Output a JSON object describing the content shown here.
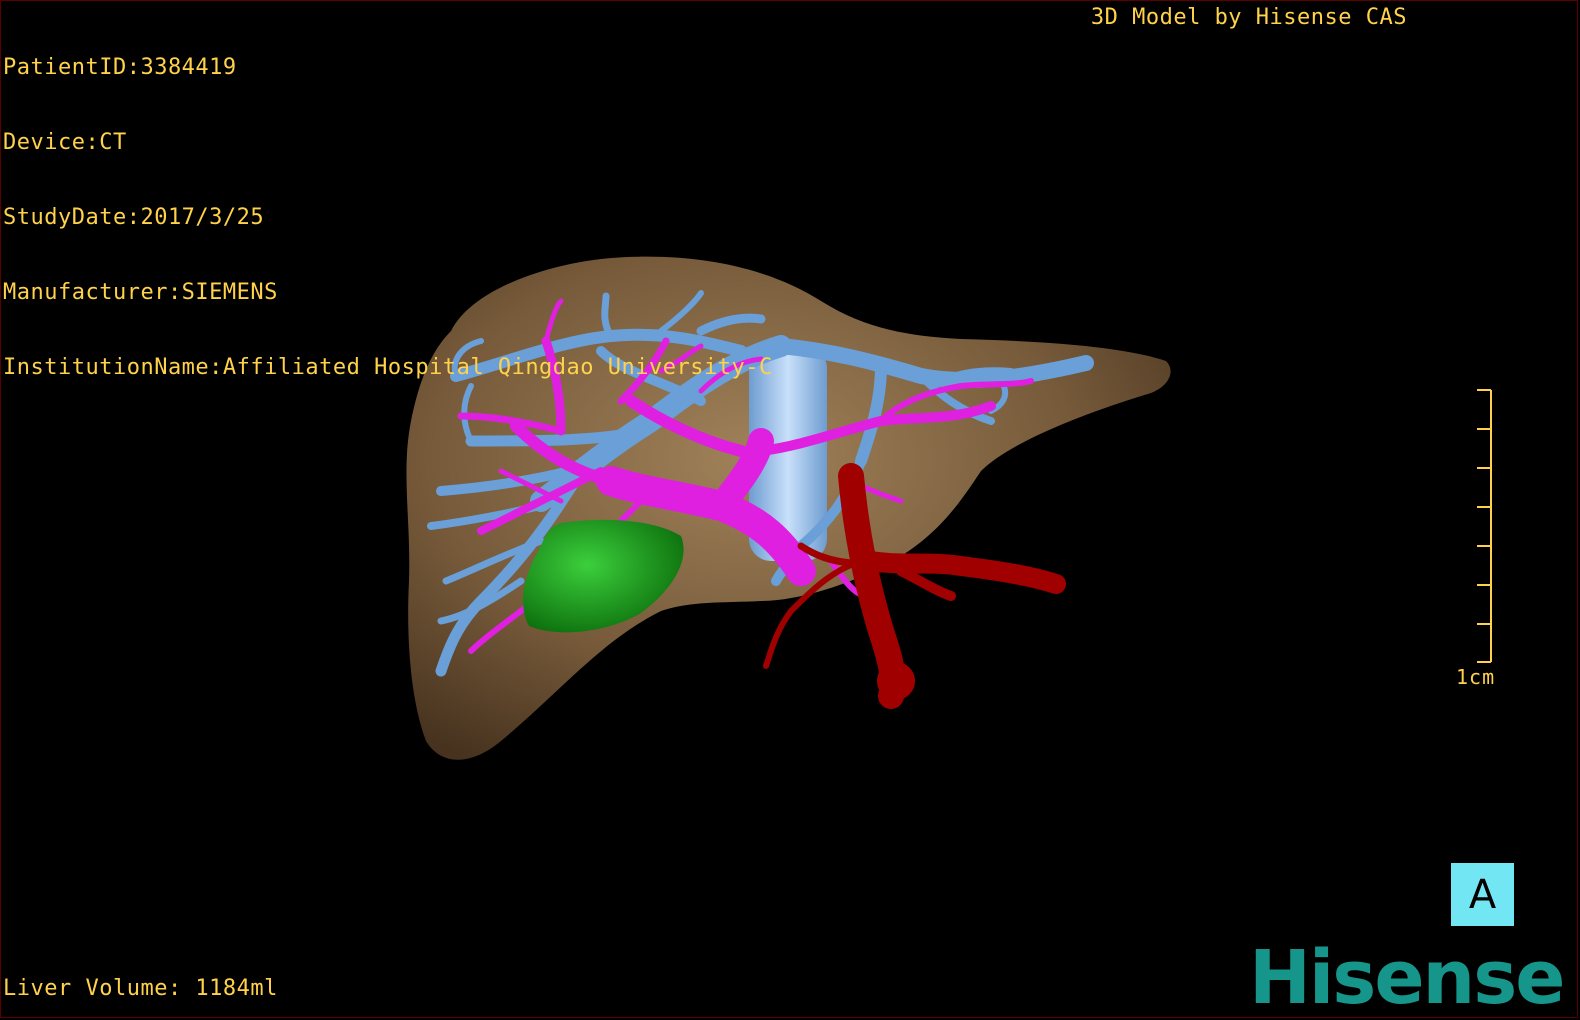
{
  "dicom_info": {
    "patient_id": "PatientID:3384419",
    "device": "Device:CT",
    "study_date": "StudyDate:2017/3/25",
    "manufacturer": "Manufacturer:SIEMENS",
    "institution": "InstitutionName:Affiliated Hospital Qingdao University-C"
  },
  "model_credit": "3D Model by Hisense CAS",
  "liver_volume": "Liver Volume: 1184ml",
  "scale": {
    "label": "1cm",
    "tick_count": 8
  },
  "orientation": "A",
  "brand": "Hisense",
  "colors": {
    "overlay_text": "#ffd24a",
    "liver": "#8a6a45",
    "hepatic_vein": "#6a9fd8",
    "portal_vein": "#e020e0",
    "artery": "#a00000",
    "gallbladder": "#1a9a1a",
    "ivc": "#a8c8f0",
    "orientation_bg": "#73e6f4",
    "brand": "#16958b"
  }
}
